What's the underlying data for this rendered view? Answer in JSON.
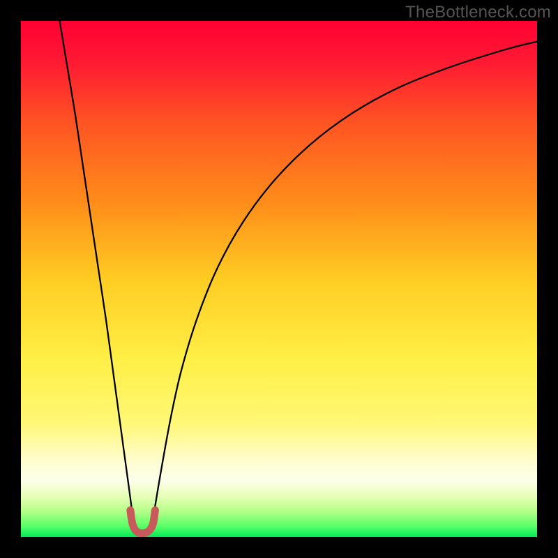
{
  "watermark": "TheBottleneck.com",
  "chart_data": {
    "type": "line",
    "title": "",
    "xlabel": "",
    "ylabel": "",
    "xlim": [
      0,
      100
    ],
    "ylim": [
      0,
      100
    ],
    "background_gradient": {
      "stops": [
        {
          "offset": 0.0,
          "color": "#ff0033"
        },
        {
          "offset": 0.08,
          "color": "#ff1a33"
        },
        {
          "offset": 0.2,
          "color": "#ff5522"
        },
        {
          "offset": 0.35,
          "color": "#ff8c1a"
        },
        {
          "offset": 0.5,
          "color": "#ffcc22"
        },
        {
          "offset": 0.65,
          "color": "#ffee44"
        },
        {
          "offset": 0.78,
          "color": "#fff877"
        },
        {
          "offset": 0.85,
          "color": "#fffccc"
        },
        {
          "offset": 0.89,
          "color": "#fdfeea"
        },
        {
          "offset": 0.92,
          "color": "#e8ffb8"
        },
        {
          "offset": 0.95,
          "color": "#b5ff88"
        },
        {
          "offset": 0.98,
          "color": "#55ff66"
        },
        {
          "offset": 1.0,
          "color": "#00e858"
        }
      ]
    },
    "series": [
      {
        "name": "left-branch",
        "x": [
          7.5,
          9,
          10.5,
          12,
          13.5,
          15,
          16.5,
          18,
          19.5,
          21,
          21.8
        ],
        "y": [
          100,
          91,
          82,
          72,
          62,
          52,
          42,
          31,
          20,
          9,
          3
        ],
        "stroke": "#000000",
        "stroke_width": 2.3
      },
      {
        "name": "right-branch",
        "x": [
          25.5,
          27,
          29,
          31,
          34,
          38,
          43,
          49,
          56,
          64,
          73,
          83,
          94,
          100
        ],
        "y": [
          3,
          12,
          23,
          32,
          42,
          52,
          61,
          69,
          76,
          82,
          87,
          91,
          94.5,
          96
        ],
        "stroke": "#000000",
        "stroke_width": 2.3
      },
      {
        "name": "valley-marker",
        "x": [
          21.2,
          21.6,
          22.2,
          23.0,
          24.0,
          24.9,
          25.6,
          26.0
        ],
        "y": [
          5.2,
          2.6,
          1.3,
          0.8,
          0.8,
          1.3,
          2.6,
          5.2
        ],
        "stroke": "#c75a5a",
        "stroke_width": 11
      }
    ]
  }
}
